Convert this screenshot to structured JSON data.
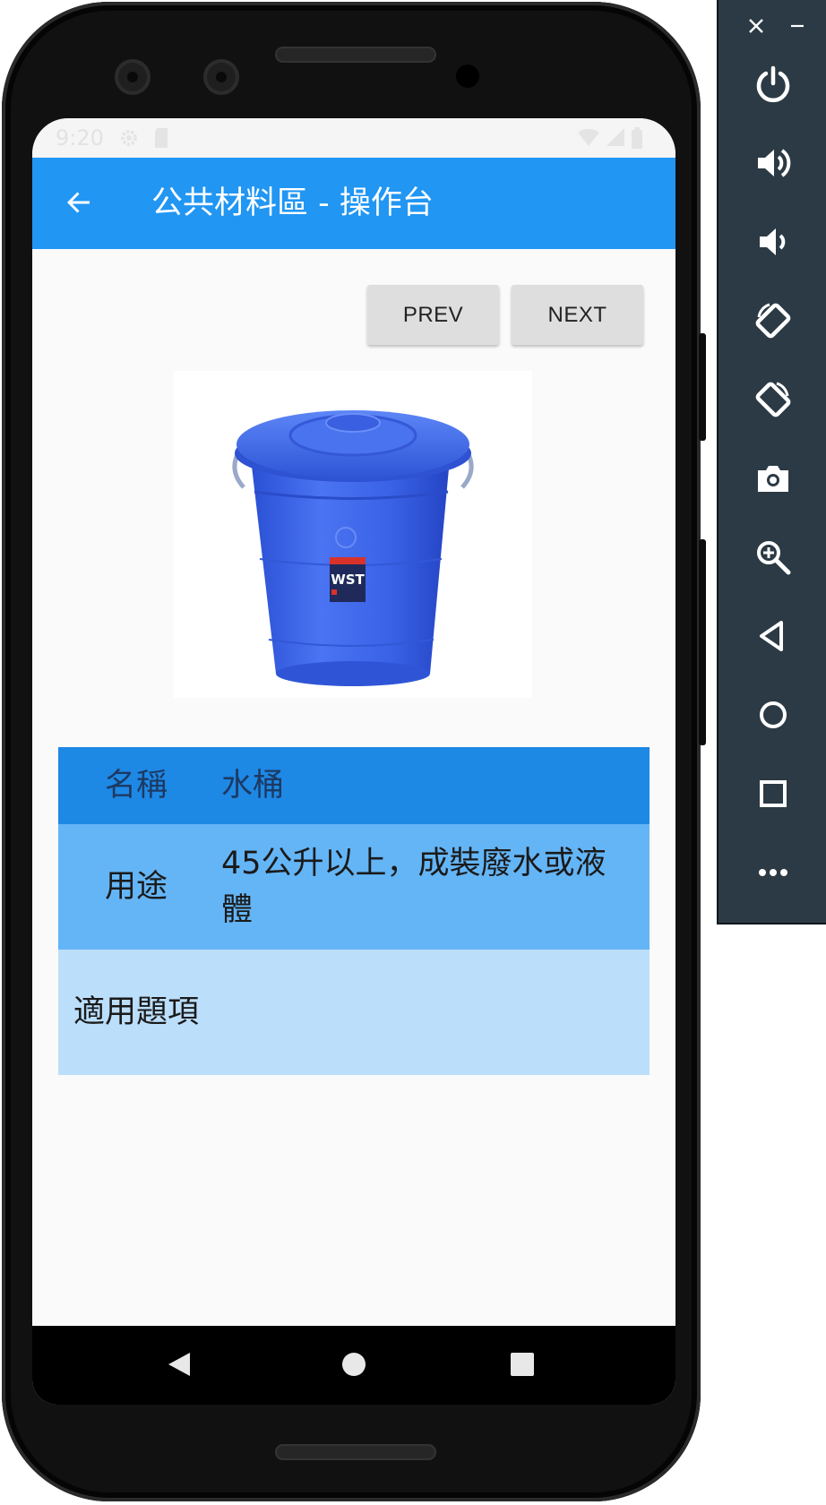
{
  "app": {
    "title": "公共材料區 - 操作台"
  },
  "status_bar": {
    "time": "9:20"
  },
  "nav": {
    "prev_label": "PREV",
    "next_label": "NEXT"
  },
  "item_table": {
    "rows": [
      {
        "key": "名稱",
        "value": "水桶"
      },
      {
        "key": "用途",
        "value": "45公升以上，成裝廢水或液體"
      },
      {
        "key": "適用題項",
        "value": ""
      }
    ]
  },
  "product_image": {
    "badge_text": "WST"
  },
  "colors": {
    "app_bar": "#2196f3",
    "table_header_row": "#1e88e5",
    "table_row_1": "#64b5f6",
    "table_row_2": "#bbdefb",
    "bucket_blue": "#3b63e6",
    "toolbar_bg": "#2b3a44"
  },
  "icons": {
    "back": "arrow-back-icon",
    "system_nav": [
      "nav-back-icon",
      "nav-home-icon",
      "nav-recents-icon"
    ],
    "emulator_window": [
      "close-icon",
      "minimize-icon"
    ],
    "emulator_tools": [
      "power-icon",
      "volume-up-icon",
      "volume-down-icon",
      "rotate-left-icon",
      "rotate-right-icon",
      "camera-icon",
      "zoom-icon",
      "back-icon",
      "home-icon",
      "overview-icon",
      "more-icon"
    ]
  }
}
